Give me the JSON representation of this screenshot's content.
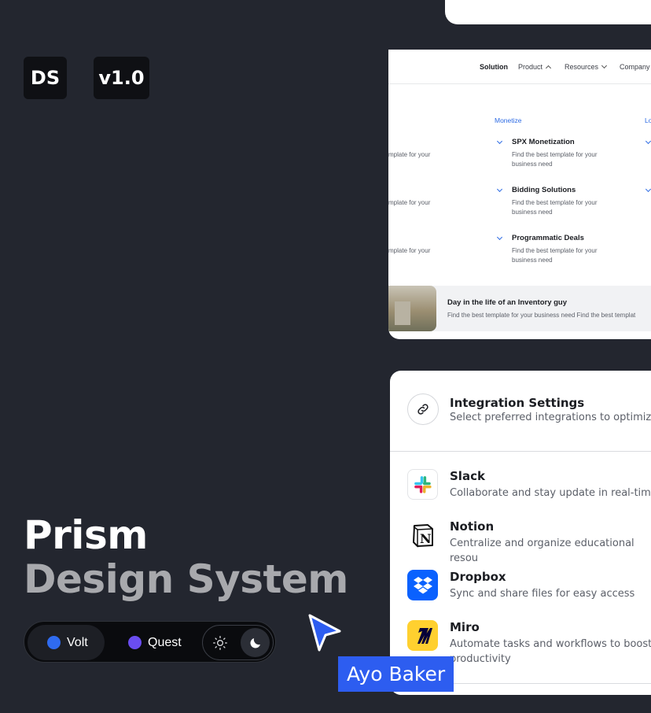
{
  "badges": {
    "ds": "DS",
    "version": "v1.0"
  },
  "hero": {
    "line1": "Prism",
    "line2": "Design System"
  },
  "switcher": {
    "options": [
      {
        "label": "Volt",
        "color": "#2f6bf0"
      },
      {
        "label": "Quest",
        "color": "#6a4df0"
      }
    ],
    "theme_icons": [
      "sun-icon",
      "moon-icon"
    ]
  },
  "nav": {
    "items": [
      "Solution",
      "Product",
      "Resources",
      "Company"
    ],
    "columns": {
      "left_descs": [
        "mplate for your",
        "mplate for your",
        "mplate for your"
      ],
      "monetize": {
        "title": "Monetize",
        "items": [
          {
            "title": "SPX Monetization",
            "desc": "Find the best template for your business need"
          },
          {
            "title": "Bidding Solutions",
            "desc": "Find the best template for your business need"
          },
          {
            "title": "Programmatic Deals",
            "desc": "Find the best template for your business need"
          }
        ]
      },
      "right_title": "Lo"
    },
    "promo": {
      "title": "Day in the life of an Inventory guy",
      "desc": "Find the best template for your business need Find the best templat"
    }
  },
  "integrations": {
    "title": "Integration Settings",
    "subtitle": "Select preferred integrations to optimize w",
    "apps": [
      {
        "name": "Slack",
        "desc": "Collaborate and stay update in real-time",
        "icon": "slack-icon"
      },
      {
        "name": "Notion",
        "desc": "Centralize and organize educational resou",
        "icon": "notion-icon"
      },
      {
        "name": "Dropbox",
        "desc": "Sync and share files for easy access",
        "icon": "dropbox-icon"
      },
      {
        "name": "Miro",
        "desc": "Automate tasks and workflows to boost productivity",
        "icon": "miro-icon"
      }
    ]
  },
  "cursor": {
    "user": "Ayo Baker",
    "color": "#2d5df0"
  }
}
